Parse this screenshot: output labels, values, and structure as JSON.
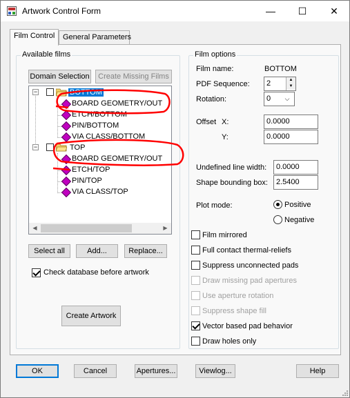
{
  "window": {
    "title": "Artwork Control Form",
    "minimize_glyph": "—",
    "maximize_glyph": "☐",
    "close_glyph": "✕"
  },
  "tabs": [
    {
      "label": "Film Control",
      "active": true
    },
    {
      "label": "General Parameters",
      "active": false
    }
  ],
  "available_films": {
    "group_label": "Available films",
    "domain_selection_label": "Domain Selection",
    "create_missing_films_label": "Create Missing Films",
    "tree": [
      {
        "label": "BOTTOM",
        "type": "film",
        "selected": true
      },
      {
        "label": "BOARD GEOMETRY/OUTLINE",
        "type": "layer",
        "display": "BOARD GEOMETRY/OUT"
      },
      {
        "label": "ETCH/BOTTOM",
        "type": "layer"
      },
      {
        "label": "PIN/BOTTOM",
        "type": "layer"
      },
      {
        "label": "VIA CLASS/BOTTOM",
        "type": "layer"
      },
      {
        "label": "TOP",
        "type": "film",
        "selected": false
      },
      {
        "label": "BOARD GEOMETRY/OUTLINE",
        "type": "layer",
        "display": "BOARD GEOMETRY/OUT"
      },
      {
        "label": "ETCH/TOP",
        "type": "layer"
      },
      {
        "label": "PIN/TOP",
        "type": "layer"
      },
      {
        "label": "VIA CLASS/TOP",
        "type": "layer"
      }
    ],
    "select_all_label": "Select all",
    "add_label": "Add...",
    "replace_label": "Replace...",
    "check_database_label": "Check database before artwork",
    "check_database_checked": true,
    "create_artwork_label": "Create Artwork"
  },
  "film_options": {
    "group_label": "Film options",
    "film_name_label": "Film name:",
    "film_name_value": "BOTTOM",
    "pdf_sequence_label": "PDF Sequence:",
    "pdf_sequence_value": "2",
    "rotation_label": "Rotation:",
    "rotation_value": "0",
    "offset_label": "Offset",
    "offset_x_label": "X:",
    "offset_x_value": "0.0000",
    "offset_y_label": "Y:",
    "offset_y_value": "0.0000",
    "undefined_line_width_label": "Undefined line width:",
    "undefined_line_width_value": "0.0000",
    "shape_bounding_box_label": "Shape bounding box:",
    "shape_bounding_box_value": "2.5400",
    "plot_mode_label": "Plot mode:",
    "plot_mode_options": [
      "Positive",
      "Negative"
    ],
    "plot_mode_selected": "Positive",
    "checkboxes": [
      {
        "label": "Film mirrored",
        "checked": false,
        "enabled": true
      },
      {
        "label": "Full contact thermal-reliefs",
        "checked": false,
        "enabled": true
      },
      {
        "label": "Suppress unconnected pads",
        "checked": false,
        "enabled": true
      },
      {
        "label": "Draw missing pad apertures",
        "checked": false,
        "enabled": false
      },
      {
        "label": "Use aperture rotation",
        "checked": false,
        "enabled": false
      },
      {
        "label": "Suppress shape fill",
        "checked": false,
        "enabled": false
      },
      {
        "label": "Vector based pad behavior",
        "checked": true,
        "enabled": true
      },
      {
        "label": "Draw holes only",
        "checked": false,
        "enabled": true
      }
    ]
  },
  "footer": {
    "ok_label": "OK",
    "cancel_label": "Cancel",
    "apertures_label": "Apertures...",
    "viewlog_label": "Viewlog...",
    "help_label": "Help"
  },
  "colors": {
    "selection": "#0078d7",
    "annotation": "#ff0000",
    "film_icon": "#c000c0"
  }
}
